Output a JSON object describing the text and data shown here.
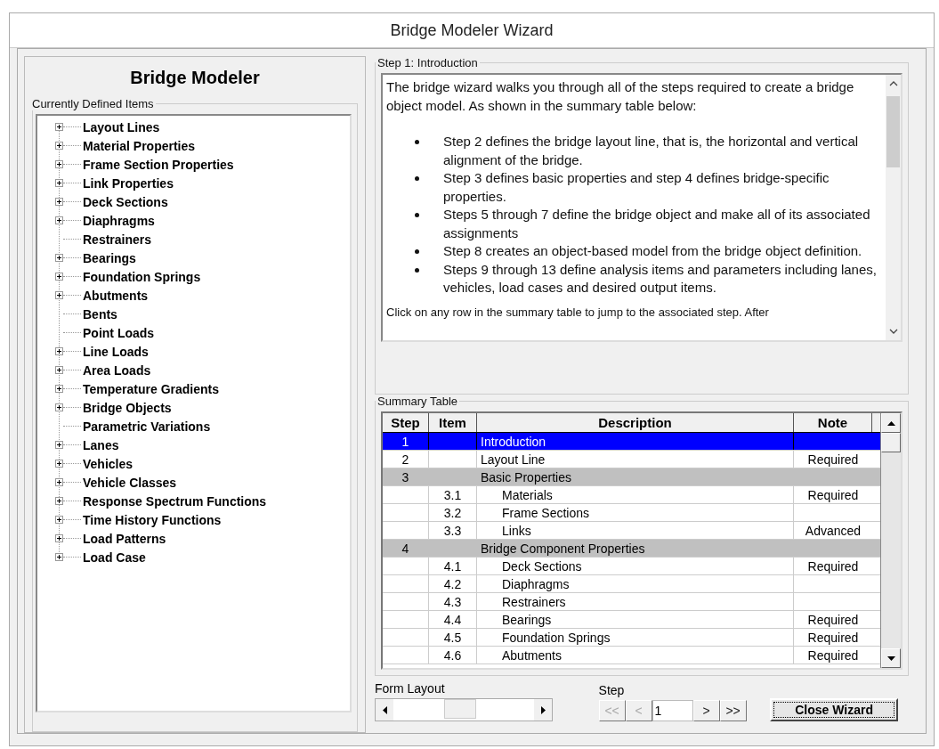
{
  "window": {
    "title": "Bridge Modeler Wizard"
  },
  "left_panel": {
    "heading": "Bridge Modeler",
    "group_label": "Currently Defined Items",
    "tree": [
      {
        "label": "Layout Lines",
        "expandable": true
      },
      {
        "label": "Material Properties",
        "expandable": true
      },
      {
        "label": "Frame Section Properties",
        "expandable": true
      },
      {
        "label": "Link Properties",
        "expandable": true
      },
      {
        "label": "Deck Sections",
        "expandable": true
      },
      {
        "label": "Diaphragms",
        "expandable": true
      },
      {
        "label": "Restrainers",
        "expandable": false
      },
      {
        "label": "Bearings",
        "expandable": true
      },
      {
        "label": "Foundation Springs",
        "expandable": true
      },
      {
        "label": "Abutments",
        "expandable": true
      },
      {
        "label": "Bents",
        "expandable": false
      },
      {
        "label": "Point Loads",
        "expandable": false
      },
      {
        "label": "Line Loads",
        "expandable": true
      },
      {
        "label": "Area Loads",
        "expandable": true
      },
      {
        "label": "Temperature Gradients",
        "expandable": true
      },
      {
        "label": "Bridge Objects",
        "expandable": true
      },
      {
        "label": "Parametric Variations",
        "expandable": false
      },
      {
        "label": "Lanes",
        "expandable": true
      },
      {
        "label": "Vehicles",
        "expandable": true
      },
      {
        "label": "Vehicle Classes",
        "expandable": true
      },
      {
        "label": "Response Spectrum Functions",
        "expandable": true
      },
      {
        "label": "Time History Functions",
        "expandable": true
      },
      {
        "label": "Load Patterns",
        "expandable": true
      },
      {
        "label": "Load Case",
        "expandable": true
      }
    ]
  },
  "step_panel": {
    "label": "Step 1:  Introduction",
    "intro": "The bridge wizard walks you through all of the steps required to create a bridge object model. As shown in the summary table below:",
    "bullets": [
      "Step 2 defines the bridge layout line, that is, the horizontal and vertical alignment of the bridge.",
      "Step 3 defines basic properties and step 4 defines bridge-specific properties.",
      "Steps 5 through 7 define the bridge object and make all of its associated assignments",
      "Step 8 creates an object-based model from the bridge object definition.",
      "Steps 9 through 13 define analysis items and parameters including lanes, vehicles, load cases and desired output items."
    ],
    "outro": "Click on any row in the summary table to jump to the associated step. After"
  },
  "summary_table": {
    "label": "Summary Table",
    "columns": [
      "Step",
      "Item",
      "Description",
      "Note"
    ],
    "rows": [
      {
        "kind": "step",
        "step": "1",
        "item": "",
        "description": "Introduction",
        "note": "",
        "selected": true
      },
      {
        "kind": "step",
        "step": "2",
        "item": "",
        "description": "Layout Line",
        "note": "Required",
        "selected": false
      },
      {
        "kind": "group",
        "step": "3",
        "item": "",
        "description": "Basic Properties",
        "note": "",
        "selected": false
      },
      {
        "kind": "item",
        "step": "",
        "item": "3.1",
        "description": "Materials",
        "note": "Required",
        "selected": false
      },
      {
        "kind": "item",
        "step": "",
        "item": "3.2",
        "description": "Frame Sections",
        "note": "",
        "selected": false
      },
      {
        "kind": "item",
        "step": "",
        "item": "3.3",
        "description": "Links",
        "note": "Advanced",
        "selected": false
      },
      {
        "kind": "group",
        "step": "4",
        "item": "",
        "description": "Bridge Component Properties",
        "note": "",
        "selected": false
      },
      {
        "kind": "item",
        "step": "",
        "item": "4.1",
        "description": "Deck Sections",
        "note": "Required",
        "selected": false
      },
      {
        "kind": "item",
        "step": "",
        "item": "4.2",
        "description": "Diaphragms",
        "note": "",
        "selected": false
      },
      {
        "kind": "item",
        "step": "",
        "item": "4.3",
        "description": "Restrainers",
        "note": "",
        "selected": false
      },
      {
        "kind": "item",
        "step": "",
        "item": "4.4",
        "description": "Bearings",
        "note": "Required",
        "selected": false
      },
      {
        "kind": "item",
        "step": "",
        "item": "4.5",
        "description": "Foundation Springs",
        "note": "Required",
        "selected": false
      },
      {
        "kind": "item",
        "step": "",
        "item": "4.6",
        "description": "Abutments",
        "note": "Required",
        "selected": false
      }
    ]
  },
  "form_layout": {
    "label": "Form Layout",
    "level": 0.47
  },
  "step_nav": {
    "label": "Step",
    "value": "1",
    "buttons": [
      {
        "text": "<<",
        "disabled": true
      },
      {
        "text": "<",
        "disabled": true
      },
      {
        "text": ">",
        "disabled": false
      },
      {
        "text": ">>",
        "disabled": false
      }
    ]
  },
  "close_button": "Close Wizard"
}
